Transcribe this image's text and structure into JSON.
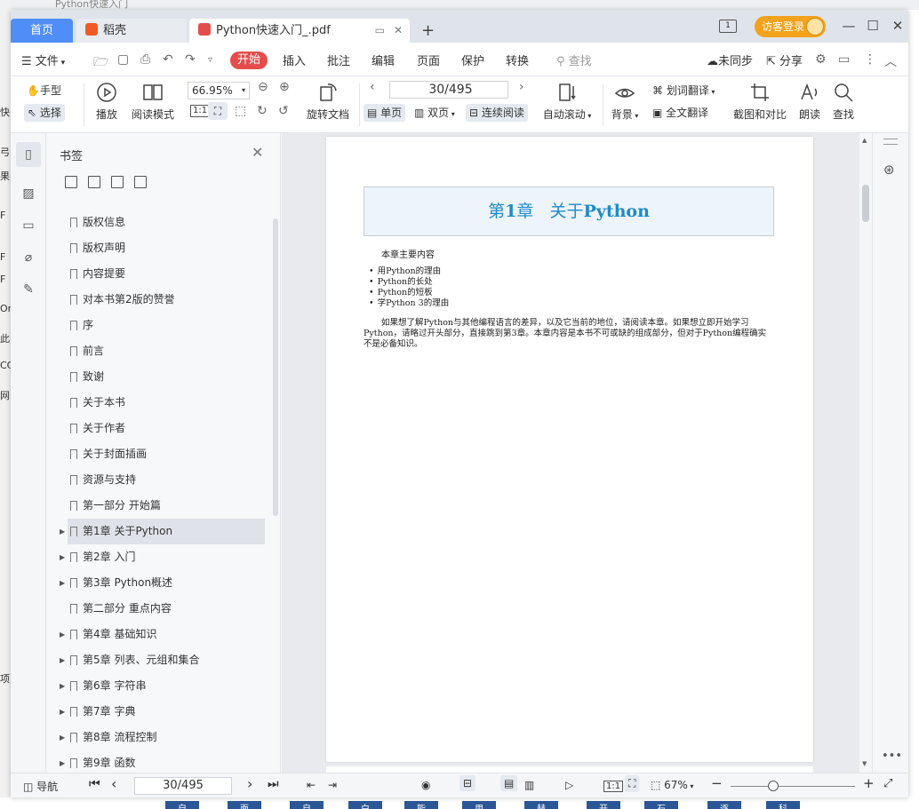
{
  "background": {
    "window_title": "Python快速入门",
    "left_chars": [
      "快",
      "弓",
      "果",
      "F",
      "F",
      "F",
      "Or",
      "此",
      "CC",
      "网",
      "项"
    ],
    "bottom_chars": [
      "自",
      "面",
      "自",
      "白",
      "能",
      "用",
      "赫",
      "开",
      "石",
      "逐",
      "科"
    ]
  },
  "titlebar": {
    "tabs": [
      {
        "label": "首页"
      },
      {
        "label": "稻壳"
      },
      {
        "label": "Python快速入门_.pdf"
      }
    ],
    "new_tab": "+",
    "panel_label": "1",
    "visitor_login": "访客登录",
    "minimize": "—",
    "maximize": "☐",
    "close": "✕"
  },
  "menu": {
    "file": "文件",
    "active": "开始",
    "items": [
      "插入",
      "批注",
      "编辑",
      "页面",
      "保护",
      "转换"
    ],
    "search": "查找",
    "sync": "未同步",
    "share": "分享"
  },
  "ribbon": {
    "hand": "手型",
    "select": "选择",
    "play": "播放",
    "read_mode": "阅读模式",
    "zoom": "66.95%",
    "rotate": "旋转文档",
    "page_input": "30/495",
    "single": "单页",
    "double": "双页",
    "continuous": "连续阅读",
    "auto_scroll": "自动滚动",
    "background": "背景",
    "word_translate": "划词翻译",
    "full_translate": "全文翻译",
    "screenshot": "截图和对比",
    "read_aloud": "朗读",
    "find": "查找"
  },
  "bookmarks": {
    "title": "书签",
    "items": [
      {
        "label": "版权信息",
        "expandable": false
      },
      {
        "label": "版权声明",
        "expandable": false
      },
      {
        "label": "内容提要",
        "expandable": false
      },
      {
        "label": "对本书第2版的赞誉",
        "expandable": false
      },
      {
        "label": "序",
        "expandable": false
      },
      {
        "label": "前言",
        "expandable": false
      },
      {
        "label": "致谢",
        "expandable": false
      },
      {
        "label": "关于本书",
        "expandable": false
      },
      {
        "label": "关于作者",
        "expandable": false
      },
      {
        "label": "关于封面插画",
        "expandable": false
      },
      {
        "label": "资源与支持",
        "expandable": false
      },
      {
        "label": "第一部分 开始篇",
        "expandable": false
      },
      {
        "label": "第1章 关于Python",
        "expandable": true,
        "selected": true
      },
      {
        "label": "第2章 入门",
        "expandable": true
      },
      {
        "label": "第3章 Python概述",
        "expandable": true
      },
      {
        "label": "第二部分 重点内容",
        "expandable": false
      },
      {
        "label": "第4章 基础知识",
        "expandable": true
      },
      {
        "label": "第5章 列表、元组和集合",
        "expandable": true
      },
      {
        "label": "第6章 字符串",
        "expandable": true
      },
      {
        "label": "第7章 字典",
        "expandable": true
      },
      {
        "label": "第8章 流程控制",
        "expandable": true
      },
      {
        "label": "第9章 函数",
        "expandable": true
      }
    ]
  },
  "document": {
    "chapter_prefix": "第",
    "chapter_num": "1",
    "chapter_suffix": "章",
    "chapter_title_cn": "关于",
    "chapter_title_en": "Python",
    "summary_heading": "本章主要内容",
    "bullets": [
      "用Python的理由",
      "Python的长处",
      "Python的短板",
      "学Python 3的理由"
    ],
    "paragraph": "如果想了解Python与其他编程语言的差异，以及它当前的地位，请阅读本章。如果想立即开始学习Python，请略过开头部分，直接跳到第3章。本章内容是本书不可或缺的组成部分，但对于Python编程确实不是必备知识。"
  },
  "statusbar": {
    "nav": "导航",
    "page_input": "30/495",
    "zoom": "67%"
  },
  "colors": {
    "home_tab": "#4f8ef7",
    "active_menu": "#e54c4c",
    "visitor": "#f2a21b",
    "chapter_title": "#1d8bc9"
  }
}
